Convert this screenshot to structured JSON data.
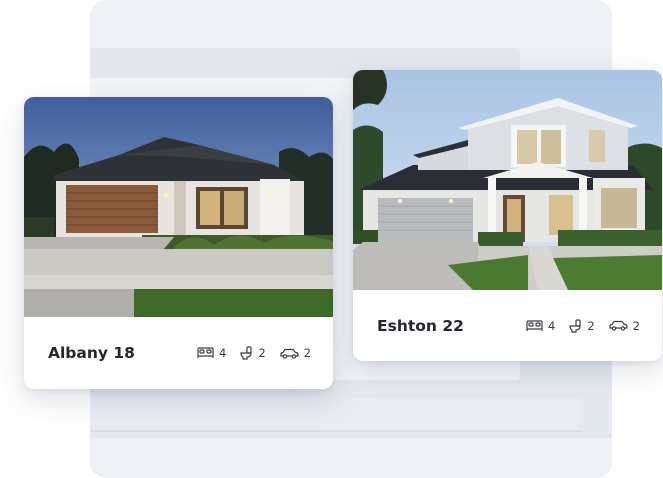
{
  "cards": [
    {
      "title": "Albany 18",
      "specs": {
        "bedrooms": "4",
        "bathrooms": "2",
        "garage": "2"
      },
      "icons": {
        "bedrooms": "bed-icon",
        "bathrooms": "toilet-icon",
        "garage": "car-icon"
      }
    },
    {
      "title": "Eshton 22",
      "specs": {
        "bedrooms": "4",
        "bathrooms": "2",
        "garage": "2"
      },
      "icons": {
        "bedrooms": "bed-icon",
        "bathrooms": "toilet-icon",
        "garage": "car-icon"
      }
    }
  ],
  "colors": {
    "card_title": "#23282e",
    "spec_text": "#3a3f47",
    "background_device": "#e9ecf1"
  }
}
